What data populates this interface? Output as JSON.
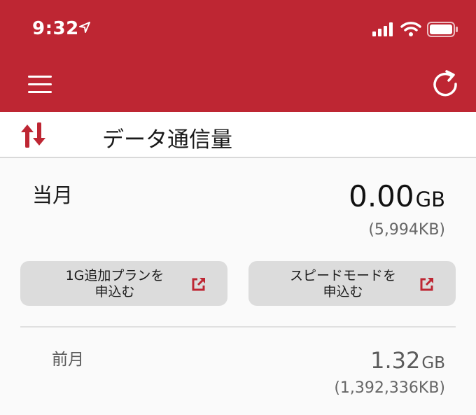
{
  "status_bar": {
    "time": "9:32",
    "location_icon": "location-arrow-icon",
    "signal_icon": "cell-signal-icon",
    "wifi_icon": "wifi-icon",
    "battery_icon": "battery-icon"
  },
  "app_bar": {
    "menu_icon": "hamburger-menu-icon",
    "refresh_icon": "refresh-icon",
    "background_color": "#be2633"
  },
  "section": {
    "icon": "data-transfer-arrows-icon",
    "title": "データ通信量"
  },
  "current_month": {
    "label": "当月",
    "value": "0.00",
    "unit": "GB",
    "kb": "(5,994KB)"
  },
  "buttons": {
    "add_1g": {
      "line1": "1G追加プランを",
      "line2": "申込む",
      "icon": "external-link-icon"
    },
    "speed_mode": {
      "line1": "スピードモードを",
      "line2": "申込む",
      "icon": "external-link-icon"
    }
  },
  "previous_month": {
    "label": "前月",
    "value": "1.32",
    "unit": "GB",
    "kb": "(1,392,336KB)"
  },
  "colors": {
    "accent": "#be2633",
    "button_bg": "#dcdcdc"
  }
}
